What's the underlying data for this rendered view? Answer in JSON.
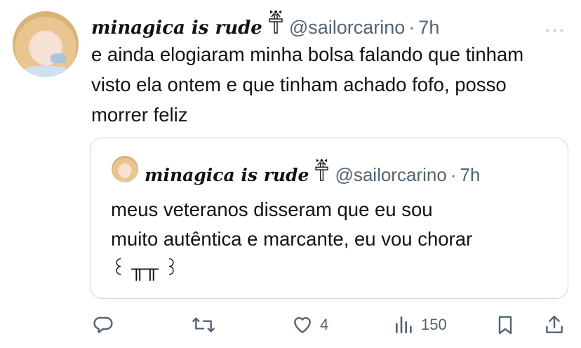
{
  "tweet": {
    "author_name": "minagica is rude",
    "handle": "@sailorcarino",
    "separator": "·",
    "time": "7h",
    "text": "e ainda elogiaram minha bolsa falando que tinham visto ela ontem e que tinham achado fofo, posso morrer feliz"
  },
  "quoted_tweet": {
    "author_name": "minagica is rude",
    "handle": "@sailorcarino",
    "separator": "·",
    "time": "7h",
    "text_line1": "meus veteranos disseram que eu sou",
    "text_line2": "muito autêntica e marcante, eu vou chorar",
    "text_line3": "꒰ ╥╥ ꒱"
  },
  "actions": {
    "reply_icon": "reply-icon",
    "retweet_icon": "retweet-icon",
    "like_icon": "heart-icon",
    "like_count": "4",
    "views_icon": "views-icon",
    "views_count": "150",
    "bookmark_icon": "bookmark-icon",
    "share_icon": "share-icon"
  },
  "colors": {
    "text": "#0f1419",
    "secondary": "#536471",
    "border": "#cfd9de",
    "background": "#ffffff"
  }
}
